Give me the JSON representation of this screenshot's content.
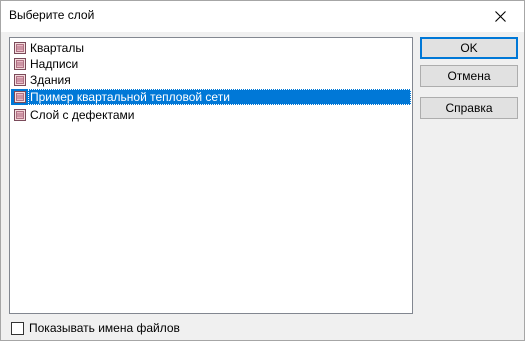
{
  "window": {
    "title": "Выберите слой"
  },
  "layers": [
    {
      "label": "Кварталы",
      "selected": false
    },
    {
      "label": "Надписи",
      "selected": false
    },
    {
      "label": "Здания",
      "selected": false
    },
    {
      "label": "Пример квартальной тепловой сети",
      "selected": true
    },
    {
      "label": "Слой с дефектами",
      "selected": false
    }
  ],
  "buttons": {
    "ok": "OK",
    "cancel": "Отмена",
    "help": "Справка"
  },
  "options": {
    "show_file_names_label": "Показывать имена файлов",
    "show_file_names_checked": false
  },
  "colors": {
    "selection": "#0078d7",
    "default_button_border": "#0078d7"
  },
  "icons": {
    "layer": "layer-icon",
    "close": "close-icon"
  }
}
